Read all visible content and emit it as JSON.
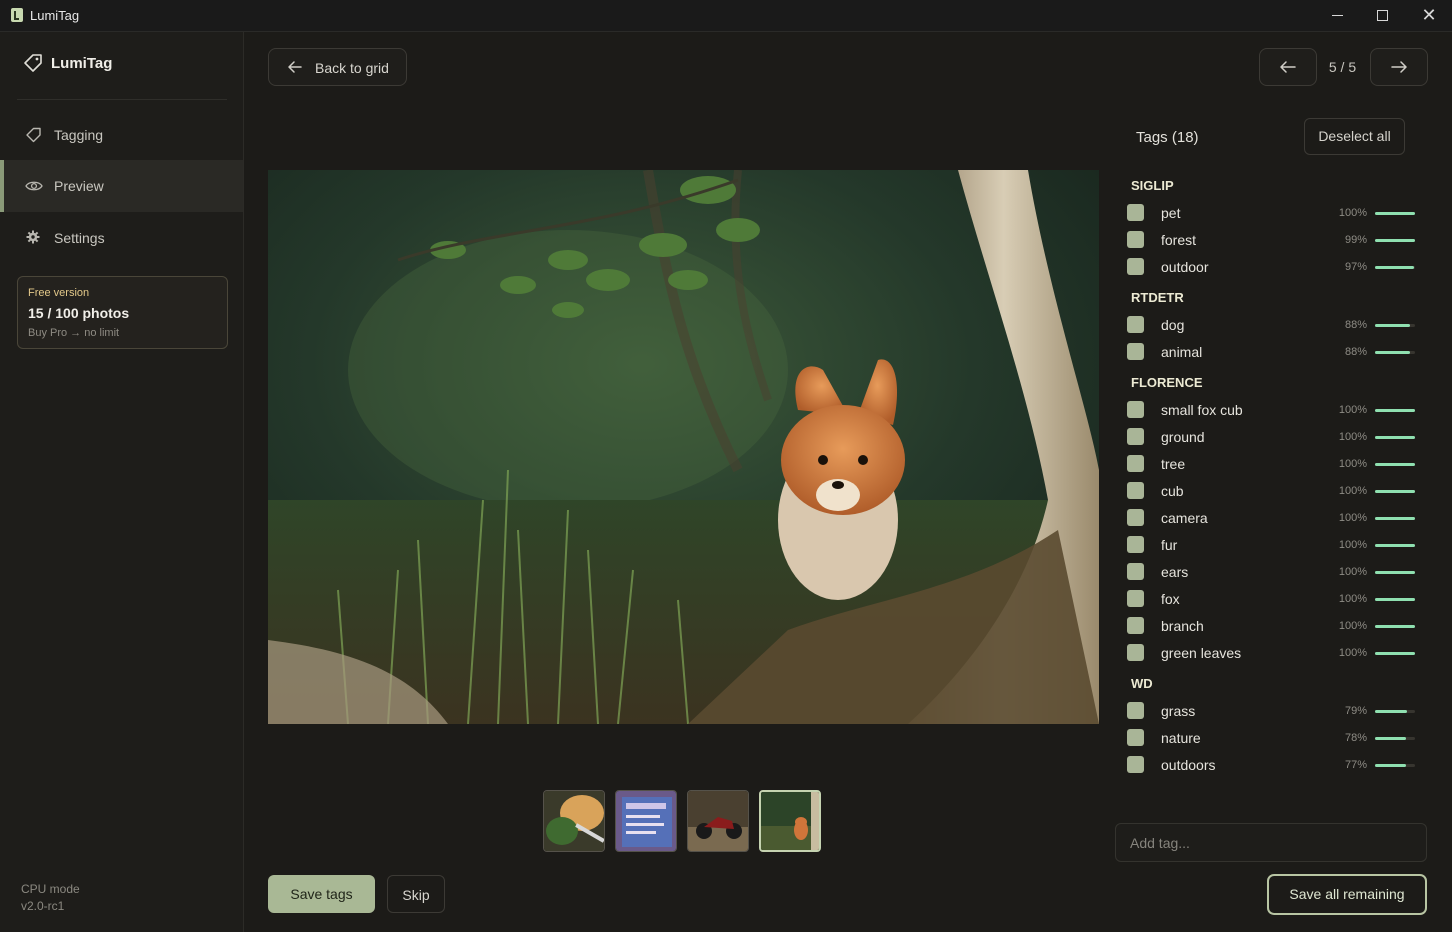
{
  "window": {
    "title": "LumiTag"
  },
  "sidebar": {
    "brand": "LumiTag",
    "items": [
      {
        "label": "Tagging",
        "icon": "tag-icon"
      },
      {
        "label": "Preview",
        "icon": "eye-icon",
        "active": true
      },
      {
        "label": "Settings",
        "icon": "gear-icon"
      }
    ],
    "free": {
      "label": "Free version",
      "count": "15 / 100 photos",
      "buy": "Buy Pro → no limit"
    },
    "footer": {
      "mode": "CPU mode",
      "version": "v2.0-rc1"
    }
  },
  "toolbar": {
    "back": "Back to grid",
    "page": "5 / 5"
  },
  "tags": {
    "title": "Tags (18)",
    "deselect": "Deselect all",
    "groups": [
      {
        "name": "SIGLIP",
        "tags": [
          {
            "name": "pet",
            "pct": "100%",
            "value": 1.0
          },
          {
            "name": "forest",
            "pct": "99%",
            "value": 0.99
          },
          {
            "name": "outdoor",
            "pct": "97%",
            "value": 0.97
          }
        ]
      },
      {
        "name": "RTDETR",
        "tags": [
          {
            "name": "dog",
            "pct": "88%",
            "value": 0.88
          },
          {
            "name": "animal",
            "pct": "88%",
            "value": 0.88
          }
        ]
      },
      {
        "name": "FLORENCE",
        "tags": [
          {
            "name": "small fox cub",
            "pct": "100%",
            "value": 1.0
          },
          {
            "name": "ground",
            "pct": "100%",
            "value": 1.0
          },
          {
            "name": "tree",
            "pct": "100%",
            "value": 1.0
          },
          {
            "name": "cub",
            "pct": "100%",
            "value": 1.0
          },
          {
            "name": "camera",
            "pct": "100%",
            "value": 1.0
          },
          {
            "name": "fur",
            "pct": "100%",
            "value": 1.0
          },
          {
            "name": "ears",
            "pct": "100%",
            "value": 1.0
          },
          {
            "name": "fox",
            "pct": "100%",
            "value": 1.0
          },
          {
            "name": "branch",
            "pct": "100%",
            "value": 1.0
          },
          {
            "name": "green leaves",
            "pct": "100%",
            "value": 1.0
          }
        ]
      },
      {
        "name": "WD",
        "tags": [
          {
            "name": "grass",
            "pct": "79%",
            "value": 0.79
          },
          {
            "name": "nature",
            "pct": "78%",
            "value": 0.78
          },
          {
            "name": "outdoors",
            "pct": "77%",
            "value": 0.77
          }
        ]
      }
    ],
    "add_placeholder": "Add tag..."
  },
  "actions": {
    "save": "Save tags",
    "skip": "Skip",
    "save_all": "Save all remaining"
  },
  "colors": {
    "accent": "#a9b895",
    "bar": "#8fe0b0",
    "free_label": "#e3c98a"
  }
}
